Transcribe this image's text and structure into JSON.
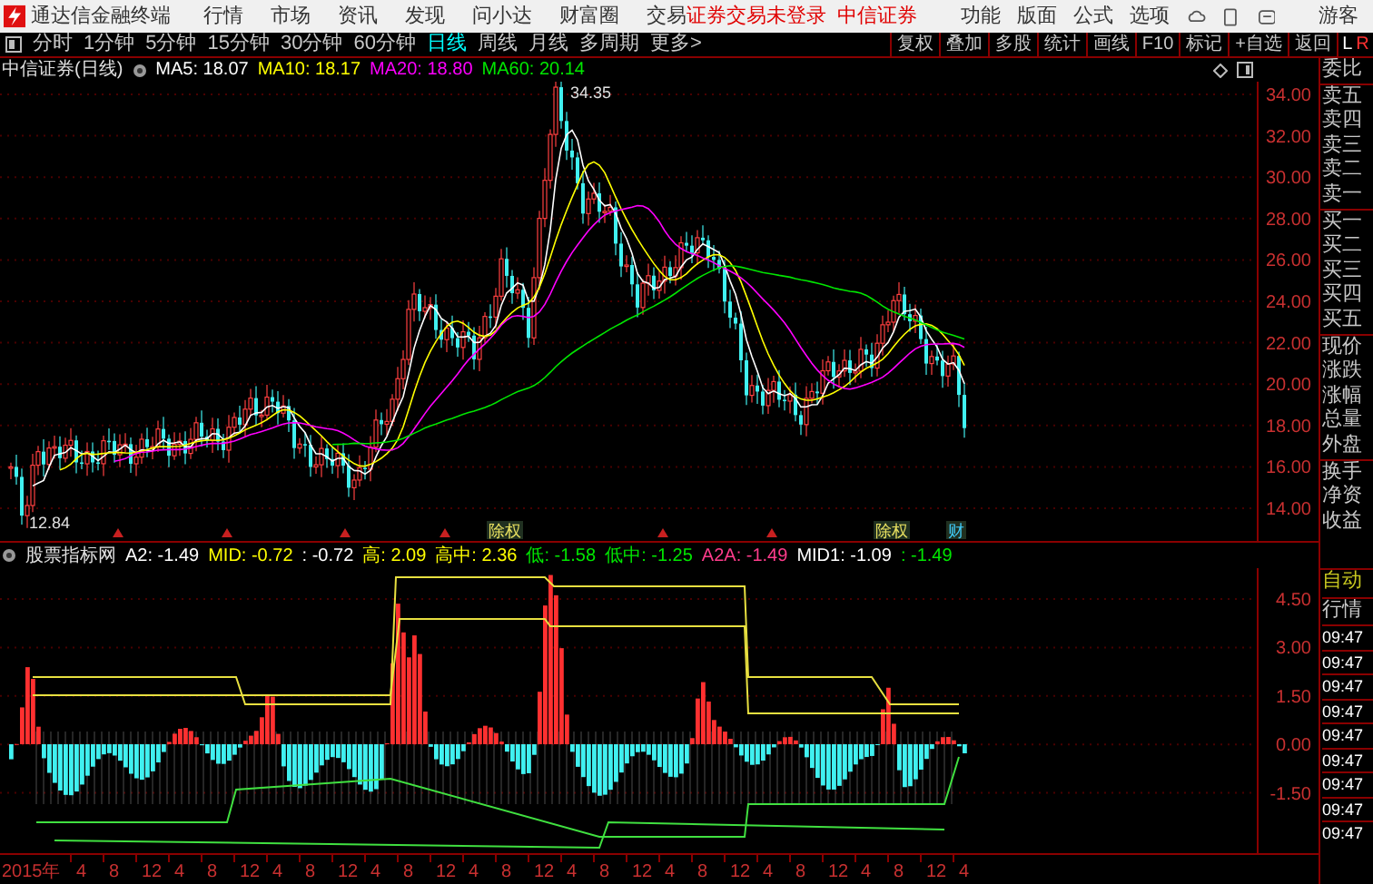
{
  "app_bar": {
    "title": "通达信金融终端",
    "menus": [
      "行情",
      "市场",
      "资讯",
      "发现",
      "问小达",
      "财富圈",
      "交易"
    ],
    "login_notice": "证券交易未登录",
    "broker": "中信证券",
    "tools": [
      "功能",
      "版面",
      "公式",
      "选项"
    ],
    "user": "游客"
  },
  "period_tabs": [
    {
      "label": "分时",
      "selected": false
    },
    {
      "label": "1分钟",
      "selected": false
    },
    {
      "label": "5分钟",
      "selected": false
    },
    {
      "label": "15分钟",
      "selected": false
    },
    {
      "label": "30分钟",
      "selected": false
    },
    {
      "label": "60分钟",
      "selected": false
    },
    {
      "label": "日线",
      "selected": true
    },
    {
      "label": "周线",
      "selected": false
    },
    {
      "label": "月线",
      "selected": false
    },
    {
      "label": "多周期",
      "selected": false
    },
    {
      "label": "更多>",
      "selected": false
    }
  ],
  "toolbar_buttons": [
    "复权",
    "叠加",
    "多股",
    "统计",
    "画线",
    "F10",
    "标记",
    "+自选",
    "返回"
  ],
  "lr_toggle": {
    "left": "L",
    "right": "R"
  },
  "price_chart": {
    "title": "中信证券(日线)",
    "ma_readings": [
      {
        "text": "MA5: 18.07",
        "color": "#ffffff"
      },
      {
        "text": "MA10: 18.17",
        "color": "#ffff00"
      },
      {
        "text": "MA20: 18.80",
        "color": "#ff00ff"
      },
      {
        "text": "MA60: 20.14",
        "color": "#00e600"
      }
    ],
    "high_label": "34.35",
    "low_label": "12.84",
    "events": [
      {
        "label": "除权"
      },
      {
        "label": "除权"
      },
      {
        "label": "财"
      }
    ],
    "y_axis": [
      "34.00",
      "32.00",
      "30.00",
      "28.00",
      "26.00",
      "24.00",
      "22.00",
      "20.00",
      "18.00",
      "16.00",
      "14.00"
    ]
  },
  "indicator": {
    "name": "股票指标网",
    "readings": [
      {
        "text": "A2: -1.49",
        "color": "#ffffff"
      },
      {
        "text": "MID: -0.72",
        "color": "#ffff00"
      },
      {
        "text": ": -0.72",
        "color": "#ffffff"
      },
      {
        "text": "高: 2.09",
        "color": "#ffff00"
      },
      {
        "text": "高中: 2.36",
        "color": "#ffff00"
      },
      {
        "text": "低: -1.58",
        "color": "#00e600"
      },
      {
        "text": "低中: -1.25",
        "color": "#00e600"
      },
      {
        "text": "A2A: -1.49",
        "color": "#ff3c8c"
      },
      {
        "text": "MID1: -1.09",
        "color": "#ffffff"
      },
      {
        "text": ": -1.49",
        "color": "#00e600"
      }
    ],
    "y_axis": [
      "4.50",
      "3.00",
      "1.50",
      "0.00",
      "-1.50"
    ]
  },
  "time_axis": [
    "2015年",
    "4",
    "8",
    "12",
    "4",
    "8",
    "12",
    "4",
    "8",
    "12",
    "4",
    "8",
    "12",
    "4",
    "8",
    "12",
    "4",
    "8",
    "12",
    "4",
    "8",
    "12",
    "4",
    "8",
    "12",
    "4",
    "8",
    "12",
    "4"
  ],
  "quote_panel": {
    "groups": [
      [
        "委比"
      ],
      [
        "卖五",
        "卖四",
        "卖三",
        "卖二",
        "卖一"
      ],
      [
        "买一",
        "买二",
        "买三",
        "买四",
        "买五"
      ],
      [
        "现价",
        "涨跌",
        "涨幅",
        "总量",
        "外盘"
      ],
      [
        "换手",
        "净资",
        "收益"
      ]
    ],
    "mode": "自动",
    "tab": "行情",
    "times": [
      "09:47",
      "09:47",
      "09:47",
      "09:47",
      "09:47",
      "09:47",
      "09:47",
      "09:47",
      "09:47"
    ]
  }
}
